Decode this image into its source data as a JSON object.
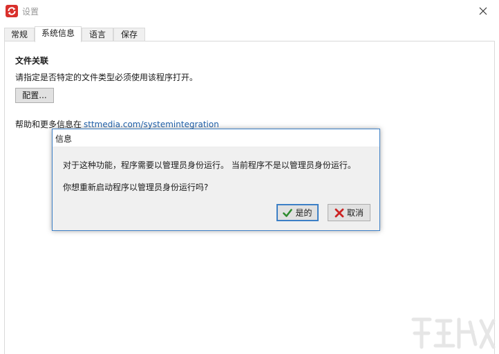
{
  "window": {
    "title": "设置"
  },
  "tabs": [
    {
      "label": "常规",
      "active": false
    },
    {
      "label": "系统信息",
      "active": true
    },
    {
      "label": "语言",
      "active": false
    },
    {
      "label": "保存",
      "active": false
    }
  ],
  "panel": {
    "section_title": "文件关联",
    "description": "请指定是否特定的文件类型必须使用该程序打开。",
    "config_button": "配置...",
    "help_prefix": "帮助和更多信息在",
    "help_link": "sttmedia.com/systemintegration"
  },
  "dialog": {
    "title": "信息",
    "message1": "对于这种功能，程序需要以管理员身份运行。 当前程序不是以管理员身份运行。",
    "message2": "你想重新启动程序以管理员身份运行吗?",
    "yes_label": "是的",
    "no_label": "取消"
  },
  "icons": {
    "app": "app-refresh-icon",
    "close": "close-icon",
    "yes": "check-icon",
    "no": "x-icon"
  },
  "colors": {
    "accent": "#3c7fc6",
    "link": "#1f5fa8",
    "check": "#2e8b2e",
    "cancel_x": "#cc2222",
    "app_icon": "#d9302c"
  }
}
